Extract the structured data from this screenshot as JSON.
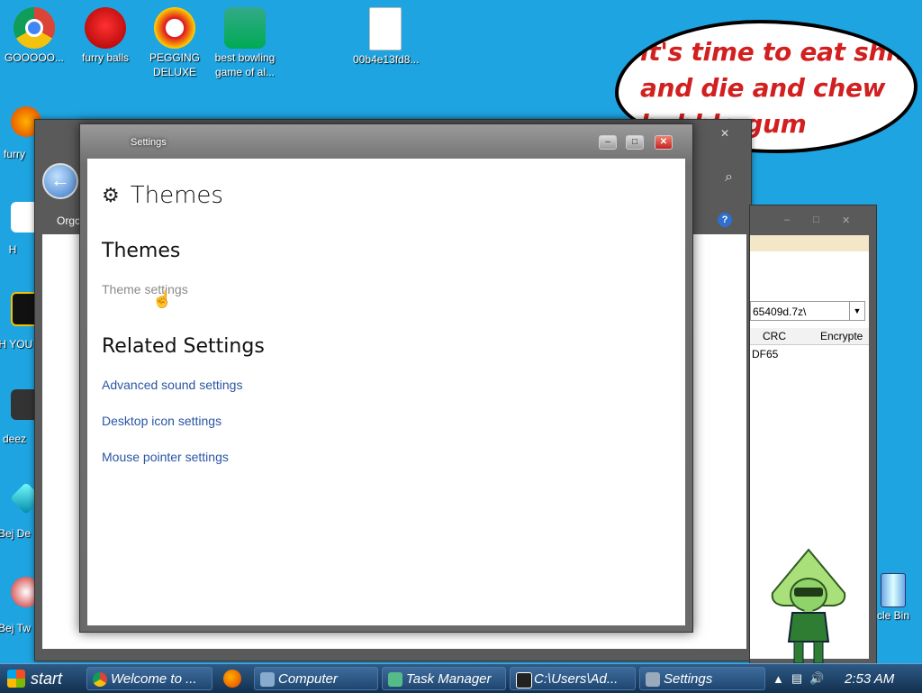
{
  "desktop": {
    "icons_top": [
      {
        "label": "GOOOOO...",
        "icon": "chrome-icon"
      },
      {
        "label": "furry balls",
        "icon": "furry-balls-icon"
      },
      {
        "label": "PEGGING DELUXE",
        "icon": "pegging-deluxe-icon"
      },
      {
        "label": "best bowling game of al...",
        "icon": "bowling-game-icon"
      },
      {
        "label": "00b4e13fd8...",
        "icon": "file-icon"
      }
    ],
    "icons_left": [
      {
        "label": "furry",
        "icon": "firefox-icon"
      },
      {
        "label": "H",
        "icon": "app-icon"
      },
      {
        "label": "I H YOU",
        "icon": "app-icon"
      },
      {
        "label": "deez",
        "icon": "app-icon"
      },
      {
        "label": "Bej De",
        "icon": "bejeweled-icon"
      },
      {
        "label": "Bej Tw",
        "icon": "bejeweled-icon"
      }
    ],
    "bubble_text": "it's time to eat shit and die and chew bubble gum",
    "recycle_bin_label": "cle Bin"
  },
  "explorer_window": {
    "nav_label": "Orgc",
    "search_glyph": "⌕"
  },
  "archive_window": {
    "address": "65409d.7z\\",
    "col_crc": "CRC",
    "col_encrypted": "Encrypte",
    "crc_value": "DF65"
  },
  "settings_window": {
    "window_title": "Settings",
    "page_title": "Themes",
    "section_themes": "Themes",
    "theme_settings_link": "Theme settings",
    "section_related": "Related Settings",
    "related_links": [
      "Advanced sound settings",
      "Desktop icon settings",
      "Mouse pointer settings"
    ]
  },
  "taskbar": {
    "start_label": "start",
    "tasks": [
      "Welcome to ...",
      "Computer",
      "Task Manager",
      "C:\\Users\\Ad...",
      "Settings"
    ],
    "clock": "2:53 AM"
  },
  "colors": {
    "desktop": "#1ea4e0",
    "link": "#2a55a5",
    "bubble_text": "#d21f1f"
  }
}
